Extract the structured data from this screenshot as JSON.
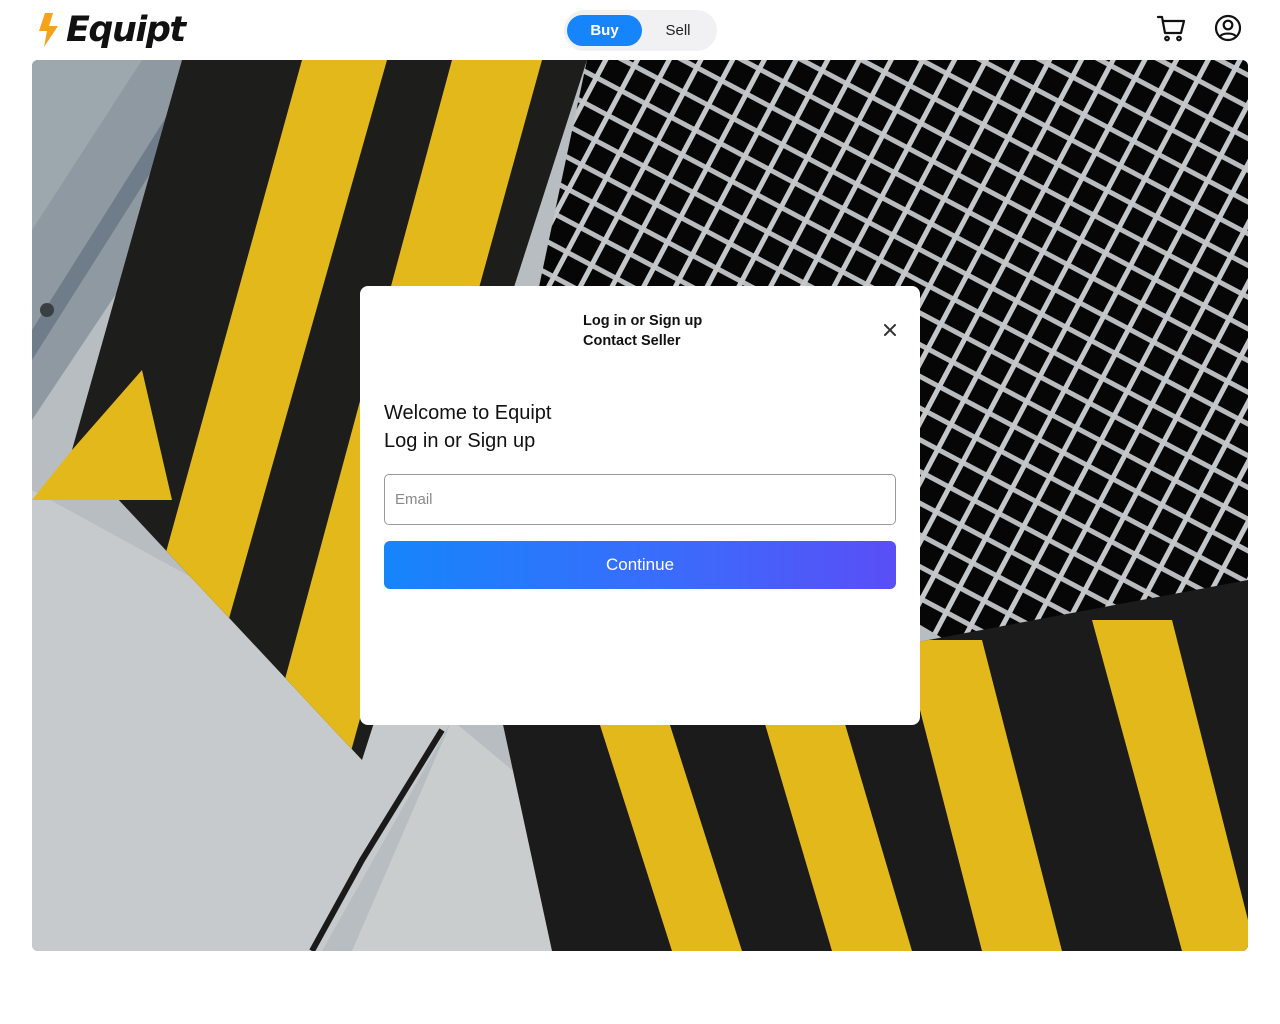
{
  "header": {
    "brand": "Equipt",
    "mode_toggle": {
      "buy_label": "Buy",
      "sell_label": "Sell",
      "selected": "Buy"
    },
    "icons": [
      "lightning-bolt-icon",
      "cart-icon",
      "account-icon"
    ]
  },
  "hero": {
    "image_description_icon": "hazard-stripes-and-grate-photo"
  },
  "modal": {
    "heading_line1": "Log in or Sign up",
    "heading_line2": "Contact Seller",
    "welcome_line1": "Welcome to Equipt",
    "welcome_line2": "Log in or Sign up",
    "email_placeholder": "Email",
    "email_value": "",
    "continue_label": "Continue",
    "close_icon": "close-icon"
  },
  "colors": {
    "accent": "#1685fb",
    "gradient_end": "#5a4ef6",
    "logo_bolt": "#f6a21a",
    "hazard_yellow": "#e3b81a"
  }
}
